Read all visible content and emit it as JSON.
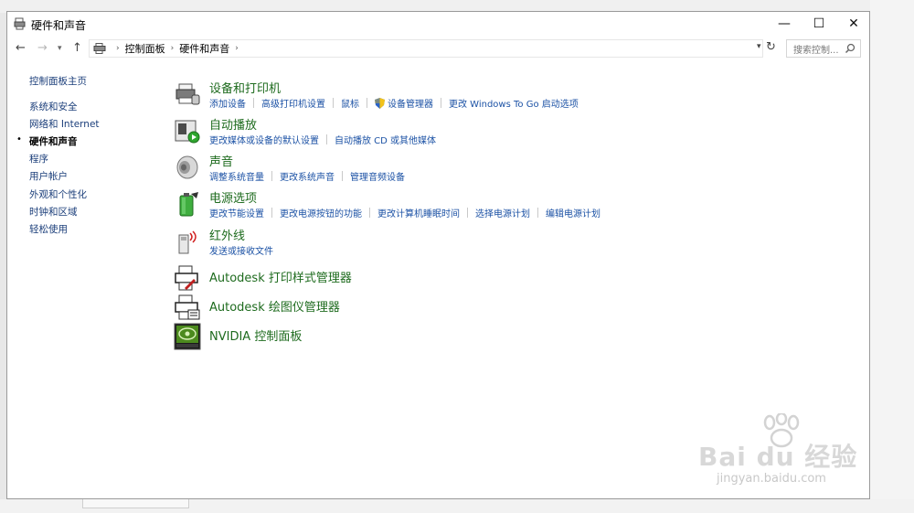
{
  "window": {
    "title": "硬件和声音",
    "minimize": "—",
    "maximize": "☐",
    "close": "✕"
  },
  "nav": {
    "back": "←",
    "forward": "→",
    "recent": "▾",
    "up": "↑",
    "breadcrumb": [
      "控制面板",
      "硬件和声音"
    ],
    "dropdown": "▾",
    "refresh": "↻",
    "search_placeholder": "搜索控制..."
  },
  "sidebar": {
    "items": [
      {
        "label": "控制面板主页",
        "selected": false
      },
      {
        "label": "系统和安全",
        "selected": false
      },
      {
        "label": "网络和 Internet",
        "selected": false
      },
      {
        "label": "硬件和声音",
        "selected": true
      },
      {
        "label": "程序",
        "selected": false
      },
      {
        "label": "用户帐户",
        "selected": false
      },
      {
        "label": "外观和个性化",
        "selected": false
      },
      {
        "label": "时钟和区域",
        "selected": false
      },
      {
        "label": "轻松使用",
        "selected": false
      }
    ],
    "bullet": "•"
  },
  "categories": [
    {
      "title": "设备和打印机",
      "icon": "printer-device-icon",
      "links": [
        "添加设备",
        "高级打印机设置",
        "鼠标",
        "设备管理器",
        "更改 Windows To Go 启动选项"
      ]
    },
    {
      "title": "自动播放",
      "icon": "autoplay-icon",
      "links": [
        "更改媒体或设备的默认设置",
        "自动播放 CD 或其他媒体"
      ]
    },
    {
      "title": "声音",
      "icon": "speaker-icon",
      "links": [
        "调整系统音量",
        "更改系统声音",
        "管理音频设备"
      ]
    },
    {
      "title": "电源选项",
      "icon": "battery-power-icon",
      "links": [
        "更改节能设置",
        "更改电源按钮的功能",
        "更改计算机睡眠时间",
        "选择电源计划",
        "编辑电源计划"
      ]
    },
    {
      "title": "红外线",
      "icon": "infrared-icon",
      "links": [
        "发送或接收文件"
      ]
    },
    {
      "title": "Autodesk 打印样式管理器",
      "icon": "autodesk-print-style-icon",
      "links": []
    },
    {
      "title": "Autodesk 绘图仪管理器",
      "icon": "autodesk-plotter-icon",
      "links": []
    },
    {
      "title": "NVIDIA 控制面板",
      "icon": "nvidia-icon",
      "links": []
    }
  ],
  "watermark": {
    "brand": "Bai du 经验",
    "url": "jingyan.baidu.com"
  },
  "colors": {
    "category_title": "#1e6b1e",
    "link": "#1c52a5",
    "sidebar_link": "#1b3e7a"
  }
}
